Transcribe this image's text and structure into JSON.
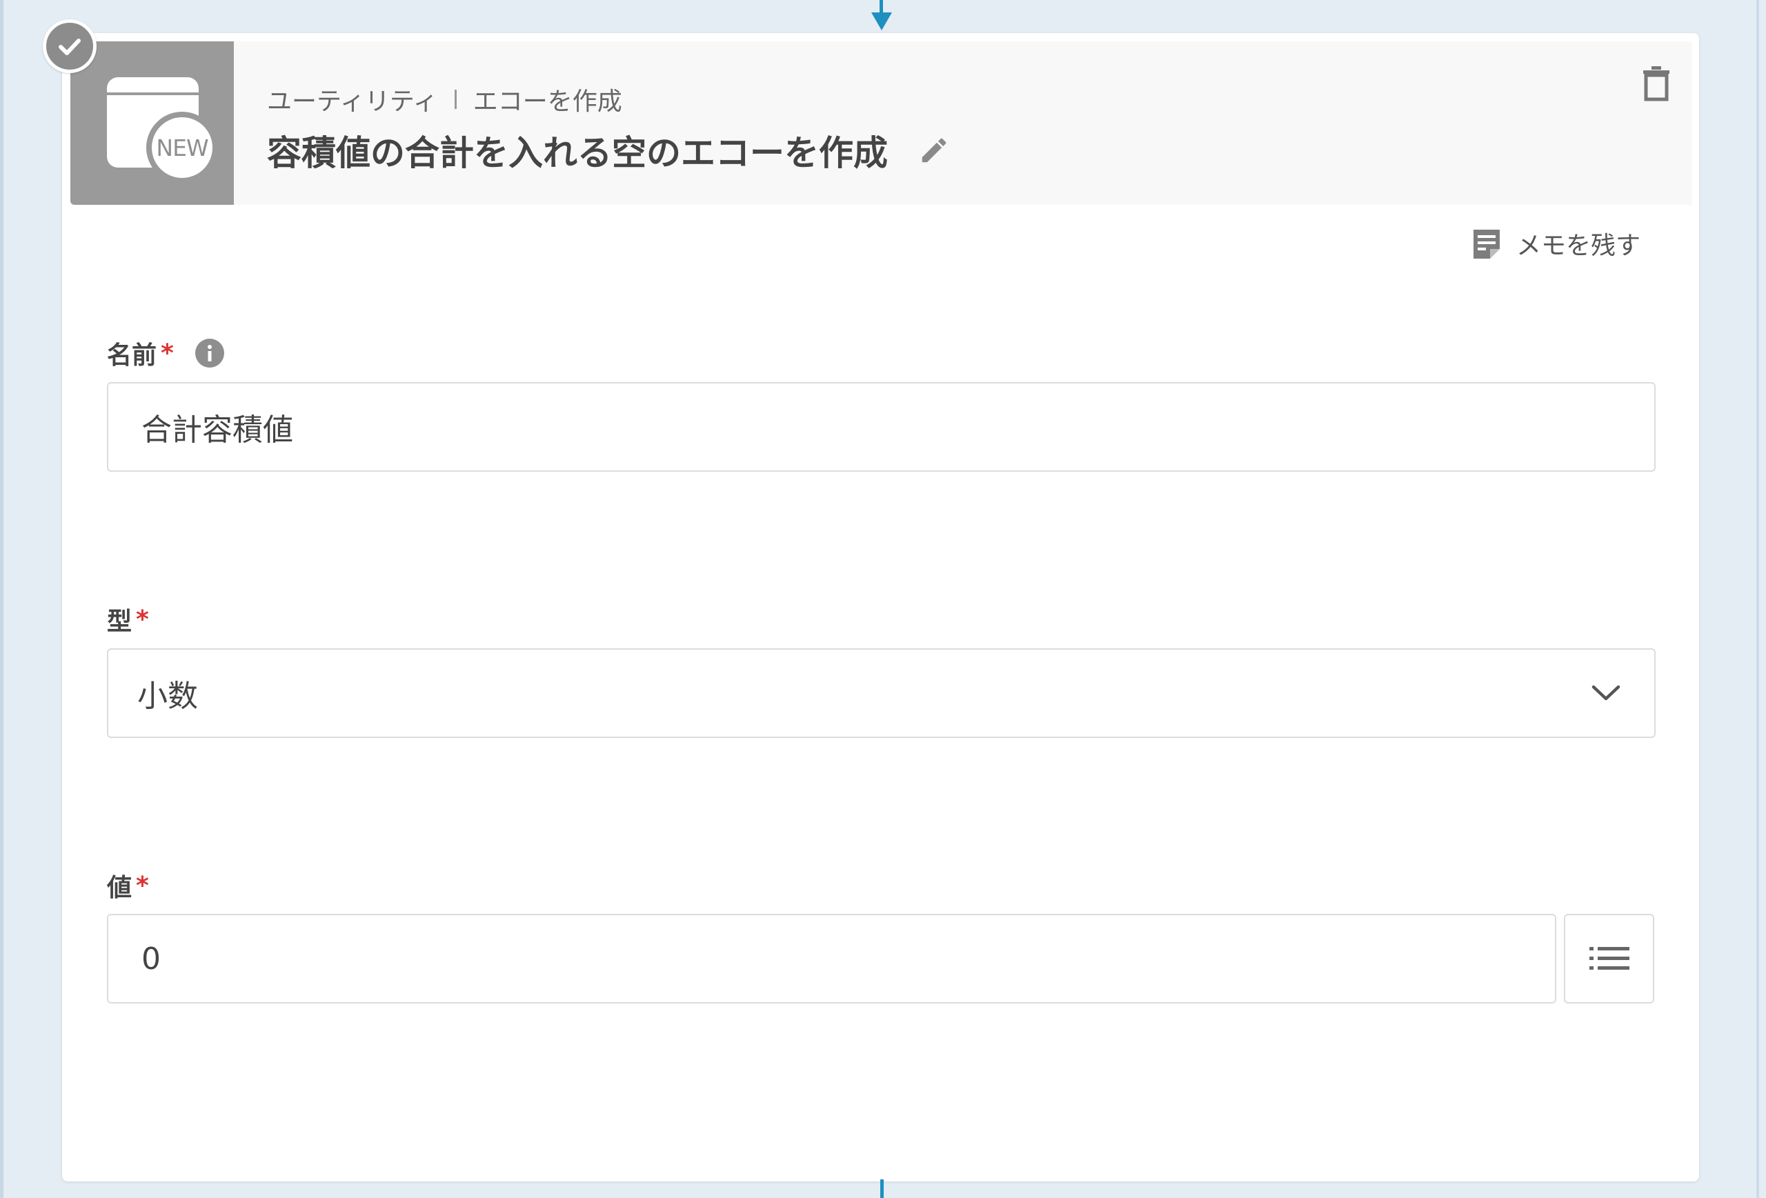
{
  "canvas": {
    "accent_color": "#1f8fc0",
    "background_color": "#e4edf4"
  },
  "step": {
    "status_icon": "check-icon",
    "app_icon": "new-echo-icon",
    "badge_text": "NEW",
    "breadcrumb": {
      "category": "ユーティリティ",
      "action": "エコーを作成"
    },
    "title": "容積値の合計を入れる空のエコーを作成",
    "edit_icon": "pencil-icon",
    "delete_icon": "trash-icon"
  },
  "memo": {
    "icon": "memo-icon",
    "label": "メモを残す"
  },
  "form": {
    "name": {
      "label": "名前",
      "required_mark": "*",
      "info_icon": "info-icon",
      "value": "合計容積値"
    },
    "type": {
      "label": "型",
      "required_mark": "*",
      "selected": "小数",
      "chevron_icon": "chevron-down-icon"
    },
    "value": {
      "label": "値",
      "required_mark": "*",
      "value": "0",
      "list_icon": "list-icon"
    }
  }
}
